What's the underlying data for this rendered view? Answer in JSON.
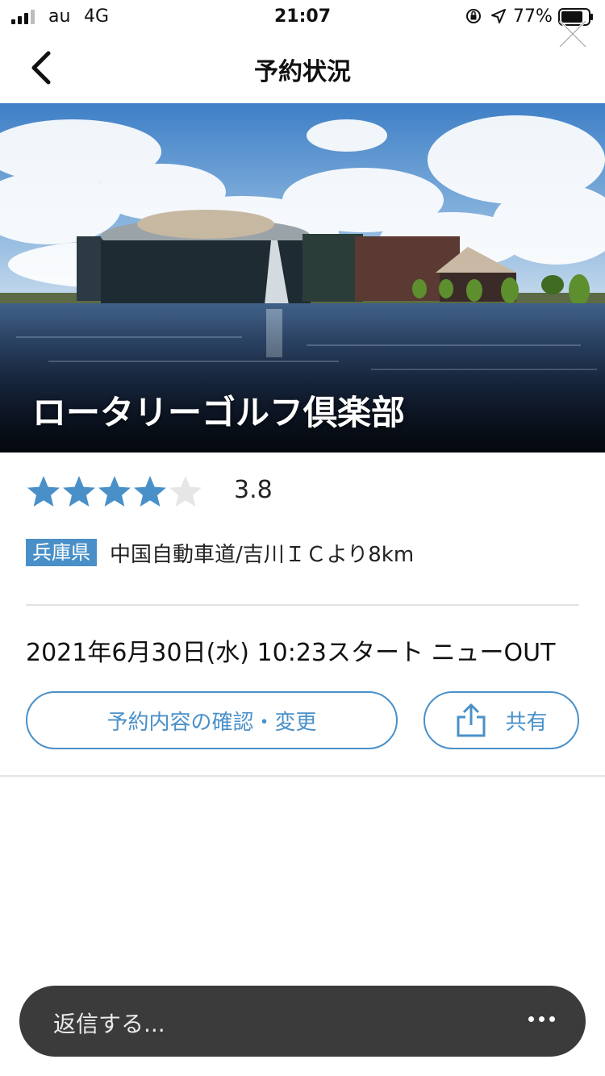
{
  "status_bar": {
    "carrier": "au",
    "network": "4G",
    "time": "21:07",
    "battery_percent": "77%"
  },
  "header": {
    "title": "予約状況"
  },
  "course": {
    "name": "ロータリーゴルフ倶楽部",
    "rating": "3.8",
    "rating_value": 3.8,
    "stars_max": 5,
    "prefecture": "兵庫県",
    "access": "中国自動車道/吉川ＩＣより8km"
  },
  "reservation": {
    "summary": "2021年6月30日(水) 10:23スタート ニューOUT"
  },
  "actions": {
    "confirm_label": "予約内容の確認・変更",
    "share_label": "共有"
  },
  "reply": {
    "placeholder": "返信する..."
  },
  "colors": {
    "accent": "#4a90c8",
    "star_filled": "#4a90c8",
    "star_empty": "#e6e6e6",
    "reply_bar": "#3b3b3b"
  },
  "icons": [
    "signal-icon",
    "orientation-lock-icon",
    "location-arrow-icon",
    "battery-icon",
    "close-icon",
    "back-chevron-icon",
    "star-icon",
    "share-icon",
    "more-icon"
  ]
}
